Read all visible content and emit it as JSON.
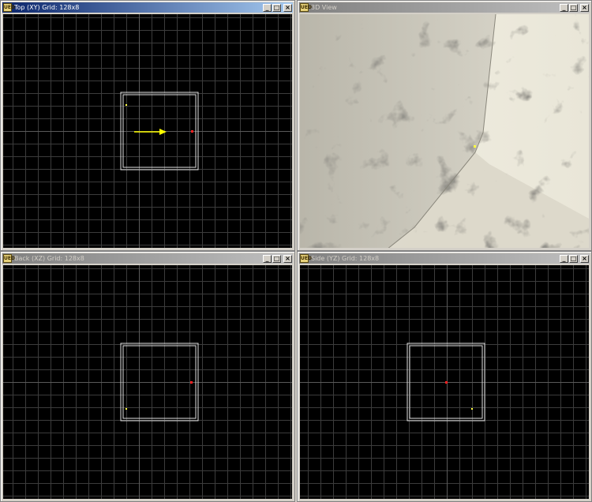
{
  "app": {
    "icon_label": "UED"
  },
  "windows": [
    {
      "id": "top",
      "title": "Top (XY) Grid: 128x8",
      "active": true
    },
    {
      "id": "3d",
      "title": "3D View",
      "active": false
    },
    {
      "id": "back",
      "title": "Back (XZ) Grid: 128x8",
      "active": false
    },
    {
      "id": "side",
      "title": "Side (YZ) Grid: 128x8",
      "active": false
    }
  ],
  "controls": {
    "minimize": "_",
    "maximize": "□",
    "close": "×"
  },
  "colors": {
    "grid_line": "#3c3c3c",
    "axis_line": "#5a5a5a",
    "brush_outline": "#e0e0e0",
    "player_start": "#ff2020",
    "light": "#ffff40",
    "direction_arrow": "#ffff00",
    "titlebar_active": "#0a246a",
    "titlebar_inactive": "#808080"
  },
  "icons": {
    "app": "unreal-editor-icon",
    "minimize": "minimize-icon",
    "maximize": "maximize-icon",
    "close": "close-icon"
  }
}
